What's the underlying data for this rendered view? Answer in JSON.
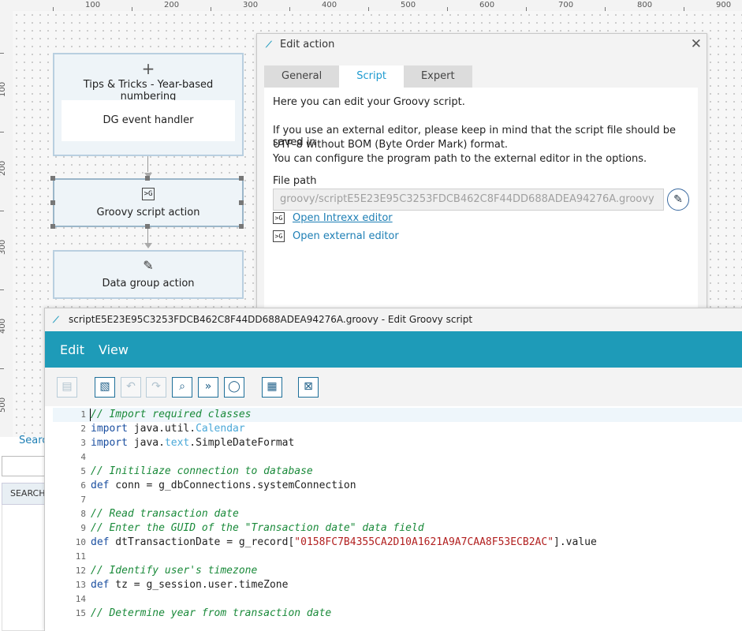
{
  "ruler": {
    "top_labels": [
      "100",
      "200",
      "300",
      "400",
      "500",
      "600",
      "700",
      "800",
      "900"
    ],
    "left_labels": [
      "100",
      "200",
      "300",
      "400",
      "500"
    ]
  },
  "workflow": {
    "tips_node": {
      "plus": "+",
      "title": "Tips & Tricks - Year-based numbering",
      "handler": "DG event handler"
    },
    "groovy_node": {
      "icon": ">G",
      "label": "Groovy script action"
    },
    "data_node": {
      "icon": "✎",
      "label": "Data group action"
    }
  },
  "edit_action": {
    "title": "Edit action",
    "close": "✕",
    "tabs": [
      {
        "label": "General"
      },
      {
        "label": "Script"
      },
      {
        "label": "Expert"
      }
    ],
    "active_tab": "Script",
    "intro": "Here you can edit your Groovy script.",
    "note_line1": "If you use an external editor, please keep in mind that the script file should be saved in",
    "note_line2": "UTF-8 without BOM (Byte Order Mark) format.",
    "note_line3": "You can configure the program path to the external editor in the options.",
    "file_path_label": "File path",
    "file_path_value": "groovy/scriptE5E23E95C3253FDCB462C8F44DD688ADEA94276A.groovy",
    "links": {
      "open_intrexx_editor": "Open Intrexx editor",
      "open_external_editor": "Open external editor"
    }
  },
  "search_panel": {
    "link": "Searc",
    "header": "SEARCH"
  },
  "groovy_editor": {
    "title": "scriptE5E23E95C3253FDCB462C8F44DD688ADEA94276A.groovy - Edit Groovy script",
    "menu": [
      "Edit",
      "View"
    ],
    "accent_color": "#1e9bb8",
    "toolbar_icons": [
      "save-icon",
      "script-library-icon",
      "undo-icon",
      "redo-icon",
      "search-icon",
      "goto-icon",
      "comment-icon",
      "calendar-icon",
      "close-editor-icon"
    ],
    "code_lines": [
      {
        "n": "1",
        "tokens": [
          [
            "c-comment",
            "// Import required classes"
          ]
        ]
      },
      {
        "n": "2",
        "tokens": [
          [
            "c-kw",
            "import"
          ],
          [
            "",
            " java.util."
          ],
          [
            "c-class",
            "Calendar"
          ]
        ]
      },
      {
        "n": "3",
        "tokens": [
          [
            "c-kw",
            "import"
          ],
          [
            "",
            " java."
          ],
          [
            "c-class",
            "text"
          ],
          [
            "",
            ".SimpleDateFormat"
          ]
        ]
      },
      {
        "n": "4",
        "tokens": []
      },
      {
        "n": "5",
        "tokens": [
          [
            "c-comment",
            "// Initiliaze connection to database"
          ]
        ]
      },
      {
        "n": "6",
        "tokens": [
          [
            "c-kw",
            "def"
          ],
          [
            "",
            " conn = g_dbConnections.systemConnection"
          ]
        ]
      },
      {
        "n": "7",
        "tokens": []
      },
      {
        "n": "8",
        "tokens": [
          [
            "c-comment",
            "// Read transaction date"
          ]
        ]
      },
      {
        "n": "9",
        "tokens": [
          [
            "c-comment",
            "// Enter the GUID of the \"Transaction date\" data field"
          ]
        ]
      },
      {
        "n": "10",
        "tokens": [
          [
            "c-kw",
            "def"
          ],
          [
            "",
            " dtTransactionDate = g_record["
          ],
          [
            "c-str",
            "\"0158FC7B4355CA2D10A1621A9A7CAA8F53ECB2AC\""
          ],
          [
            "",
            "].value"
          ]
        ]
      },
      {
        "n": "11",
        "tokens": []
      },
      {
        "n": "12",
        "tokens": [
          [
            "c-comment",
            "// Identify user's timezone"
          ]
        ]
      },
      {
        "n": "13",
        "tokens": [
          [
            "c-kw",
            "def"
          ],
          [
            "",
            " tz = g_session.user.timeZone"
          ]
        ]
      },
      {
        "n": "14",
        "tokens": []
      },
      {
        "n": "15",
        "tokens": [
          [
            "c-comment",
            "// Determine year from transaction date"
          ]
        ]
      }
    ]
  }
}
